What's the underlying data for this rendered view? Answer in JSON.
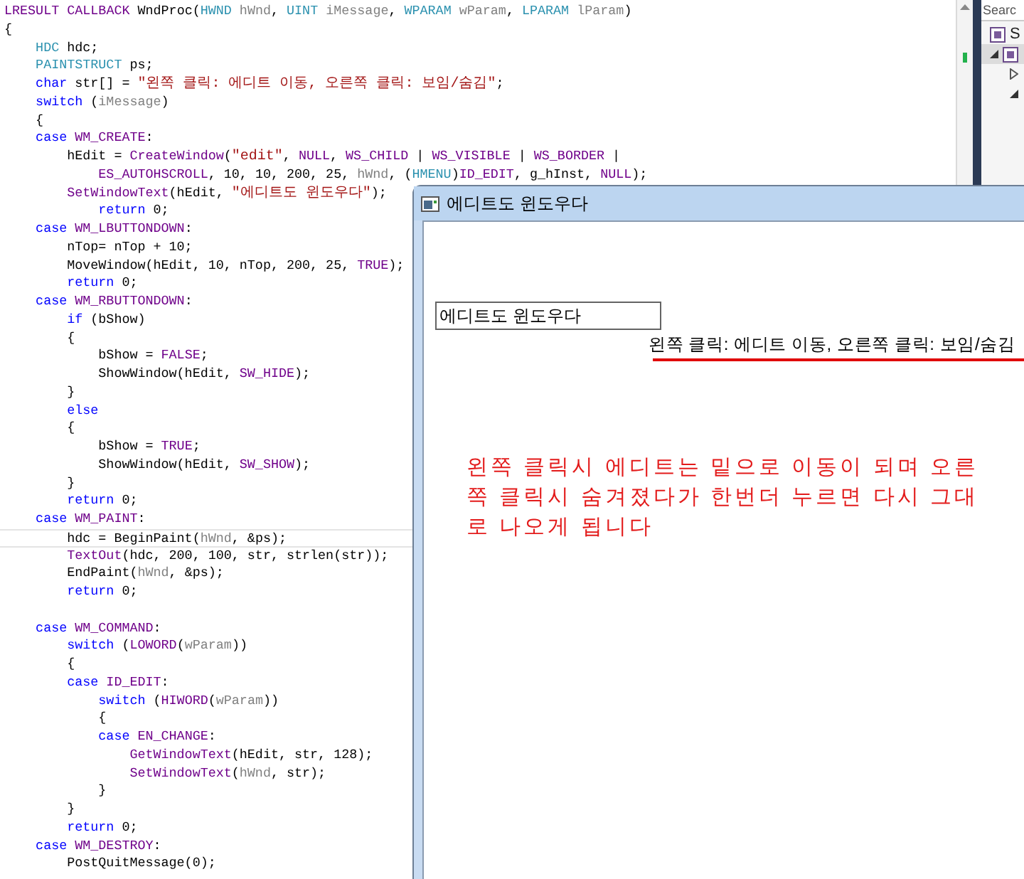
{
  "editor": {
    "lines": [
      {
        "tokens": [
          {
            "kind": "macro",
            "text": "LRESULT"
          },
          {
            "kind": "macro",
            "text": " CALLBACK"
          },
          {
            "kind": "plain",
            "text": " WndProc("
          },
          {
            "kind": "type",
            "text": "HWND"
          },
          {
            "kind": "param",
            "text": " hWnd"
          },
          {
            "kind": "plain",
            "text": ", "
          },
          {
            "kind": "type",
            "text": "UINT"
          },
          {
            "kind": "param",
            "text": " iMessage"
          },
          {
            "kind": "plain",
            "text": ", "
          },
          {
            "kind": "type",
            "text": "WPARAM"
          },
          {
            "kind": "param",
            "text": " wParam"
          },
          {
            "kind": "plain",
            "text": ", "
          },
          {
            "kind": "type",
            "text": "LPARAM"
          },
          {
            "kind": "param",
            "text": " lParam"
          },
          {
            "kind": "plain",
            "text": ")"
          }
        ]
      },
      {
        "tokens": [
          {
            "kind": "plain",
            "text": "{"
          }
        ]
      },
      {
        "tokens": [
          {
            "kind": "type",
            "text": "    HDC"
          },
          {
            "kind": "plain",
            "text": " hdc;"
          }
        ]
      },
      {
        "tokens": [
          {
            "kind": "type",
            "text": "    PAINTSTRUCT"
          },
          {
            "kind": "plain",
            "text": " ps;"
          }
        ]
      },
      {
        "tokens": [
          {
            "kind": "keyword",
            "text": "    char"
          },
          {
            "kind": "plain",
            "text": " str[] = "
          },
          {
            "kind": "string",
            "text": "\"왼쪽 클릭: 에디트 이동, 오른쪽 클릭: 보임/숨김\""
          },
          {
            "kind": "plain",
            "text": ";"
          }
        ]
      },
      {
        "tokens": [
          {
            "kind": "keyword",
            "text": "    switch"
          },
          {
            "kind": "plain",
            "text": " ("
          },
          {
            "kind": "param",
            "text": "iMessage"
          },
          {
            "kind": "plain",
            "text": ")"
          }
        ]
      },
      {
        "tokens": [
          {
            "kind": "plain",
            "text": "    {"
          }
        ]
      },
      {
        "tokens": [
          {
            "kind": "keyword",
            "text": "    case"
          },
          {
            "kind": "macro",
            "text": " WM_CREATE"
          },
          {
            "kind": "plain",
            "text": ":"
          }
        ]
      },
      {
        "tokens": [
          {
            "kind": "plain",
            "text": "        hEdit = "
          },
          {
            "kind": "macro",
            "text": "CreateWindow"
          },
          {
            "kind": "plain",
            "text": "("
          },
          {
            "kind": "string",
            "text": "\"edit\""
          },
          {
            "kind": "plain",
            "text": ", "
          },
          {
            "kind": "macro",
            "text": "NULL"
          },
          {
            "kind": "plain",
            "text": ", "
          },
          {
            "kind": "macro",
            "text": "WS_CHILD"
          },
          {
            "kind": "plain",
            "text": " | "
          },
          {
            "kind": "macro",
            "text": "WS_VISIBLE"
          },
          {
            "kind": "plain",
            "text": " | "
          },
          {
            "kind": "macro",
            "text": "WS_BORDER"
          },
          {
            "kind": "plain",
            "text": " |"
          }
        ]
      },
      {
        "tokens": [
          {
            "kind": "macro",
            "text": "            ES_AUTOHSCROLL"
          },
          {
            "kind": "plain",
            "text": ", 10, 10, 200, 25, "
          },
          {
            "kind": "param",
            "text": "hWnd"
          },
          {
            "kind": "plain",
            "text": ", ("
          },
          {
            "kind": "type",
            "text": "HMENU"
          },
          {
            "kind": "plain",
            "text": ")"
          },
          {
            "kind": "macro",
            "text": "ID_EDIT"
          },
          {
            "kind": "plain",
            "text": ", g_hInst, "
          },
          {
            "kind": "macro",
            "text": "NULL"
          },
          {
            "kind": "plain",
            "text": ");"
          }
        ]
      },
      {
        "tokens": [
          {
            "kind": "macro",
            "text": "        SetWindowText"
          },
          {
            "kind": "plain",
            "text": "(hEdit, "
          },
          {
            "kind": "string",
            "text": "\"에디트도 윈도우다\""
          },
          {
            "kind": "plain",
            "text": ");"
          }
        ]
      },
      {
        "tokens": [
          {
            "kind": "keyword",
            "text": "            return"
          },
          {
            "kind": "plain",
            "text": " 0;"
          }
        ]
      },
      {
        "tokens": [
          {
            "kind": "keyword",
            "text": "    case"
          },
          {
            "kind": "macro",
            "text": " WM_LBUTTONDOWN"
          },
          {
            "kind": "plain",
            "text": ":"
          }
        ]
      },
      {
        "tokens": [
          {
            "kind": "plain",
            "text": "        nTop= nTop + 10;"
          }
        ]
      },
      {
        "tokens": [
          {
            "kind": "plain",
            "text": "        MoveWindow(hEdit, 10, nTop, 200, 25, "
          },
          {
            "kind": "macro",
            "text": "TRUE"
          },
          {
            "kind": "plain",
            "text": ");"
          }
        ]
      },
      {
        "tokens": [
          {
            "kind": "keyword",
            "text": "        return"
          },
          {
            "kind": "plain",
            "text": " 0;"
          }
        ]
      },
      {
        "tokens": [
          {
            "kind": "keyword",
            "text": "    case"
          },
          {
            "kind": "macro",
            "text": " WM_RBUTTONDOWN"
          },
          {
            "kind": "plain",
            "text": ":"
          }
        ]
      },
      {
        "tokens": [
          {
            "kind": "keyword",
            "text": "        if"
          },
          {
            "kind": "plain",
            "text": " (bShow)"
          }
        ]
      },
      {
        "tokens": [
          {
            "kind": "plain",
            "text": "        {"
          }
        ]
      },
      {
        "tokens": [
          {
            "kind": "plain",
            "text": "            bShow = "
          },
          {
            "kind": "macro",
            "text": "FALSE"
          },
          {
            "kind": "plain",
            "text": ";"
          }
        ]
      },
      {
        "tokens": [
          {
            "kind": "plain",
            "text": "            ShowWindow(hEdit, "
          },
          {
            "kind": "macro",
            "text": "SW_HIDE"
          },
          {
            "kind": "plain",
            "text": ");"
          }
        ]
      },
      {
        "tokens": [
          {
            "kind": "plain",
            "text": "        }"
          }
        ]
      },
      {
        "tokens": [
          {
            "kind": "keyword",
            "text": "        else"
          }
        ]
      },
      {
        "tokens": [
          {
            "kind": "plain",
            "text": "        {"
          }
        ]
      },
      {
        "tokens": [
          {
            "kind": "plain",
            "text": "            bShow = "
          },
          {
            "kind": "macro",
            "text": "TRUE"
          },
          {
            "kind": "plain",
            "text": ";"
          }
        ]
      },
      {
        "tokens": [
          {
            "kind": "plain",
            "text": "            ShowWindow(hEdit, "
          },
          {
            "kind": "macro",
            "text": "SW_SHOW"
          },
          {
            "kind": "plain",
            "text": ");"
          }
        ]
      },
      {
        "tokens": [
          {
            "kind": "plain",
            "text": "        }"
          }
        ]
      },
      {
        "tokens": [
          {
            "kind": "keyword",
            "text": "        return"
          },
          {
            "kind": "plain",
            "text": " 0;"
          }
        ]
      },
      {
        "tokens": [
          {
            "kind": "keyword",
            "text": "    case"
          },
          {
            "kind": "macro",
            "text": " WM_PAINT"
          },
          {
            "kind": "plain",
            "text": ":"
          }
        ]
      },
      {
        "current": true,
        "tokens": [
          {
            "kind": "plain",
            "text": "        hdc = BeginPaint("
          },
          {
            "kind": "param",
            "text": "hWnd"
          },
          {
            "kind": "plain",
            "text": ", &ps);"
          }
        ]
      },
      {
        "tokens": [
          {
            "kind": "macro",
            "text": "        TextOut"
          },
          {
            "kind": "plain",
            "text": "(hdc, 200, 100, str, strlen(str));"
          }
        ]
      },
      {
        "tokens": [
          {
            "kind": "plain",
            "text": "        EndPaint("
          },
          {
            "kind": "param",
            "text": "hWnd"
          },
          {
            "kind": "plain",
            "text": ", &ps);"
          }
        ]
      },
      {
        "tokens": [
          {
            "kind": "keyword",
            "text": "        return"
          },
          {
            "kind": "plain",
            "text": " 0;"
          }
        ]
      },
      {
        "kind": "blank"
      },
      {
        "tokens": [
          {
            "kind": "keyword",
            "text": "    case"
          },
          {
            "kind": "macro",
            "text": " WM_COMMAND"
          },
          {
            "kind": "plain",
            "text": ":"
          }
        ]
      },
      {
        "tokens": [
          {
            "kind": "keyword",
            "text": "        switch"
          },
          {
            "kind": "plain",
            "text": " ("
          },
          {
            "kind": "macro",
            "text": "LOWORD"
          },
          {
            "kind": "plain",
            "text": "("
          },
          {
            "kind": "param",
            "text": "wParam"
          },
          {
            "kind": "plain",
            "text": "))"
          }
        ]
      },
      {
        "tokens": [
          {
            "kind": "plain",
            "text": "        {"
          }
        ]
      },
      {
        "tokens": [
          {
            "kind": "keyword",
            "text": "        case"
          },
          {
            "kind": "macro",
            "text": " ID_EDIT"
          },
          {
            "kind": "plain",
            "text": ":"
          }
        ]
      },
      {
        "tokens": [
          {
            "kind": "keyword",
            "text": "            switch"
          },
          {
            "kind": "plain",
            "text": " ("
          },
          {
            "kind": "macro",
            "text": "HIWORD"
          },
          {
            "kind": "plain",
            "text": "("
          },
          {
            "kind": "param",
            "text": "wParam"
          },
          {
            "kind": "plain",
            "text": "))"
          }
        ]
      },
      {
        "tokens": [
          {
            "kind": "plain",
            "text": "            {"
          }
        ]
      },
      {
        "tokens": [
          {
            "kind": "keyword",
            "text": "            case"
          },
          {
            "kind": "macro",
            "text": " EN_CHANGE"
          },
          {
            "kind": "plain",
            "text": ":"
          }
        ]
      },
      {
        "tokens": [
          {
            "kind": "macro",
            "text": "                GetWindowText"
          },
          {
            "kind": "plain",
            "text": "(hEdit, str, 128);"
          }
        ]
      },
      {
        "tokens": [
          {
            "kind": "macro",
            "text": "                SetWindowText"
          },
          {
            "kind": "plain",
            "text": "("
          },
          {
            "kind": "param",
            "text": "hWnd"
          },
          {
            "kind": "plain",
            "text": ", str);"
          }
        ]
      },
      {
        "tokens": [
          {
            "kind": "plain",
            "text": "            }"
          }
        ]
      },
      {
        "tokens": [
          {
            "kind": "plain",
            "text": "        }"
          }
        ]
      },
      {
        "tokens": [
          {
            "kind": "keyword",
            "text": "        return"
          },
          {
            "kind": "plain",
            "text": " 0;"
          }
        ]
      },
      {
        "tokens": [
          {
            "kind": "keyword",
            "text": "    case"
          },
          {
            "kind": "macro",
            "text": " WM_DESTROY"
          },
          {
            "kind": "plain",
            "text": ":"
          }
        ]
      },
      {
        "tokens": [
          {
            "kind": "plain",
            "text": "        PostQuitMessage(0);"
          }
        ]
      }
    ]
  },
  "solution_explorer": {
    "search": {
      "placeholder": "Searc"
    },
    "items": [
      {
        "label": "S",
        "selected": false
      },
      {
        "expanded": true,
        "selected": true,
        "children": [
          {
            "expanded": false,
            "selected": false
          },
          {
            "expanded": true,
            "selected": false
          }
        ]
      }
    ]
  },
  "app_window": {
    "title": "에디트도 윈도우다",
    "edit": {
      "value": "에디트도 윈도우다"
    },
    "output_text": "왼쪽 클릭: 에디트 이동, 오른쪽 클릭: 보임/숨김"
  },
  "annotation": {
    "text": "왼쪽 클릭시 에디트는 밑으로 이동이 되며 오른쪽 클릭시 숨겨졌다가 한번더 누르면 다시 그대로 나오게 됩니다"
  }
}
